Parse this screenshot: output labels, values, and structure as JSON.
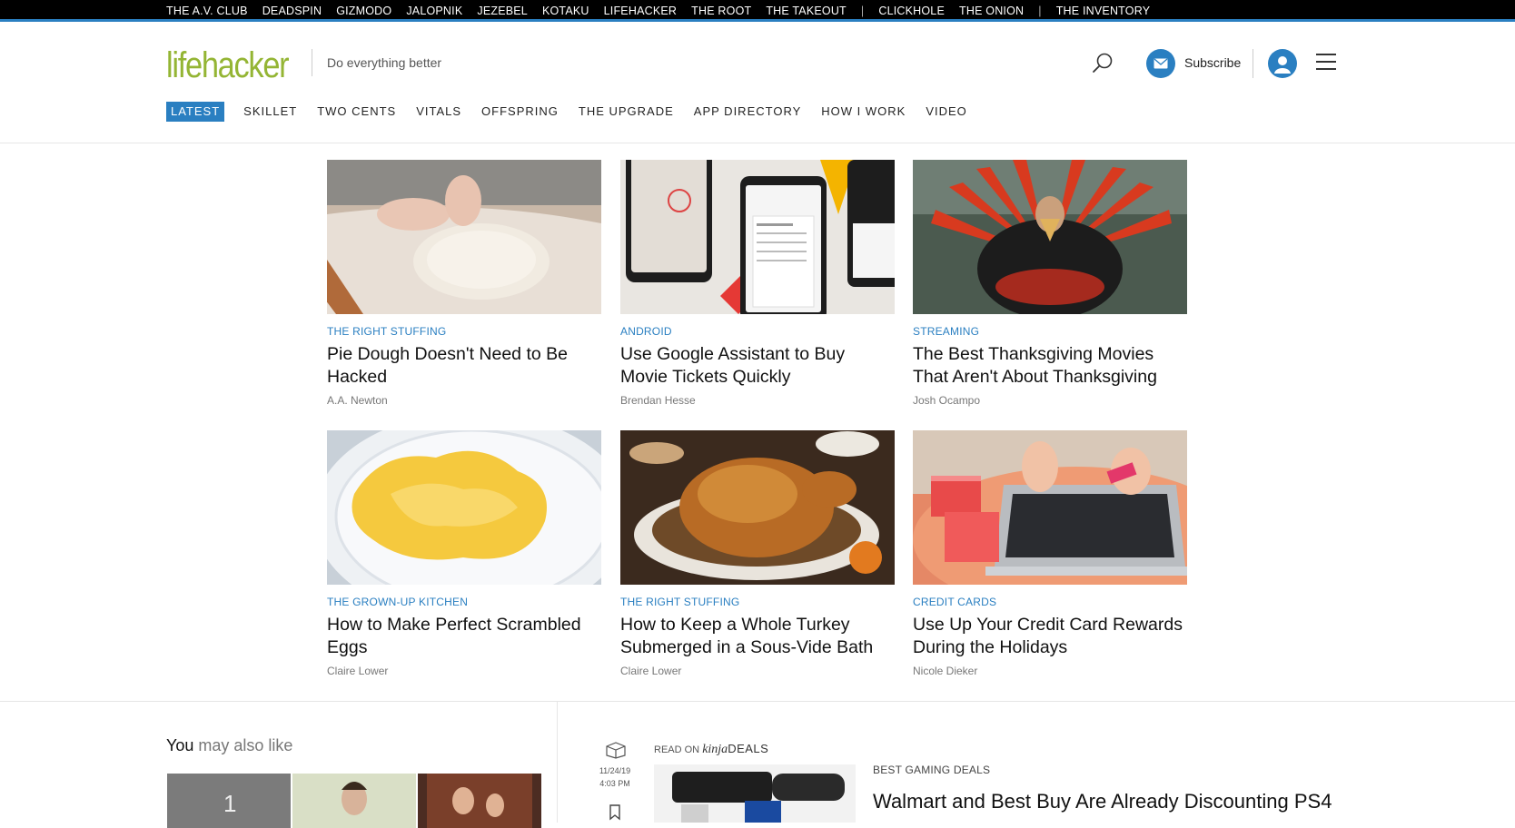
{
  "network": [
    "THE A.V. CLUB",
    "DEADSPIN",
    "GIZMODO",
    "JALOPNIK",
    "JEZEBEL",
    "KOTAKU",
    "LIFEHACKER",
    "THE ROOT",
    "THE TAKEOUT",
    "|",
    "CLICKHOLE",
    "THE ONION",
    "|",
    "THE INVENTORY"
  ],
  "header": {
    "logo": "lifehacker",
    "tagline": "Do everything better",
    "subscribe_label": "Subscribe",
    "icons": {
      "search": "search-icon",
      "mail": "mail-icon",
      "user": "user-icon",
      "menu": "hamburger-menu-icon"
    }
  },
  "sections": [
    {
      "label": "LATEST",
      "active": true
    },
    {
      "label": "SKILLET"
    },
    {
      "label": "TWO CENTS"
    },
    {
      "label": "VITALS"
    },
    {
      "label": "OFFSPRING"
    },
    {
      "label": "THE UPGRADE"
    },
    {
      "label": "APP DIRECTORY"
    },
    {
      "label": "HOW I WORK"
    },
    {
      "label": "VIDEO"
    }
  ],
  "articles": [
    {
      "category": "THE RIGHT STUFFING",
      "title": "Pie Dough Doesn't Need to Be Hacked",
      "author": "A.A. Newton"
    },
    {
      "category": "ANDROID",
      "title": "Use Google Assistant to Buy Movie Tickets Quickly",
      "author": "Brendan Hesse"
    },
    {
      "category": "STREAMING",
      "title": "The Best Thanksgiving Movies That Aren't About Thanksgiving",
      "author": "Josh Ocampo"
    },
    {
      "category": "THE GROWN-UP KITCHEN",
      "title": "How to Make Perfect Scrambled Eggs",
      "author": "Claire Lower"
    },
    {
      "category": "THE RIGHT STUFFING",
      "title": "How to Keep a Whole Turkey Submerged in a Sous-Vide Bath",
      "author": "Claire Lower"
    },
    {
      "category": "CREDIT CARDS",
      "title": "Use Up Your Credit Card Rewards During the Holidays",
      "author": "Nicole Dieker"
    }
  ],
  "also_like": {
    "bold": "You",
    "rest": "may also like",
    "first_thumb_number": "1"
  },
  "deals": {
    "read_on": "READ ON",
    "kinja": "kinja",
    "deals_word": "DEALS",
    "date": "11/24/19",
    "time": "4:03 PM",
    "category": "BEST GAMING DEALS",
    "title": "Walmart and Best Buy Are Already Discounting PS4"
  },
  "colors": {
    "accent": "#2a7fc1",
    "logo_green": "#94b534",
    "category_blue": "#2a7fc1"
  }
}
